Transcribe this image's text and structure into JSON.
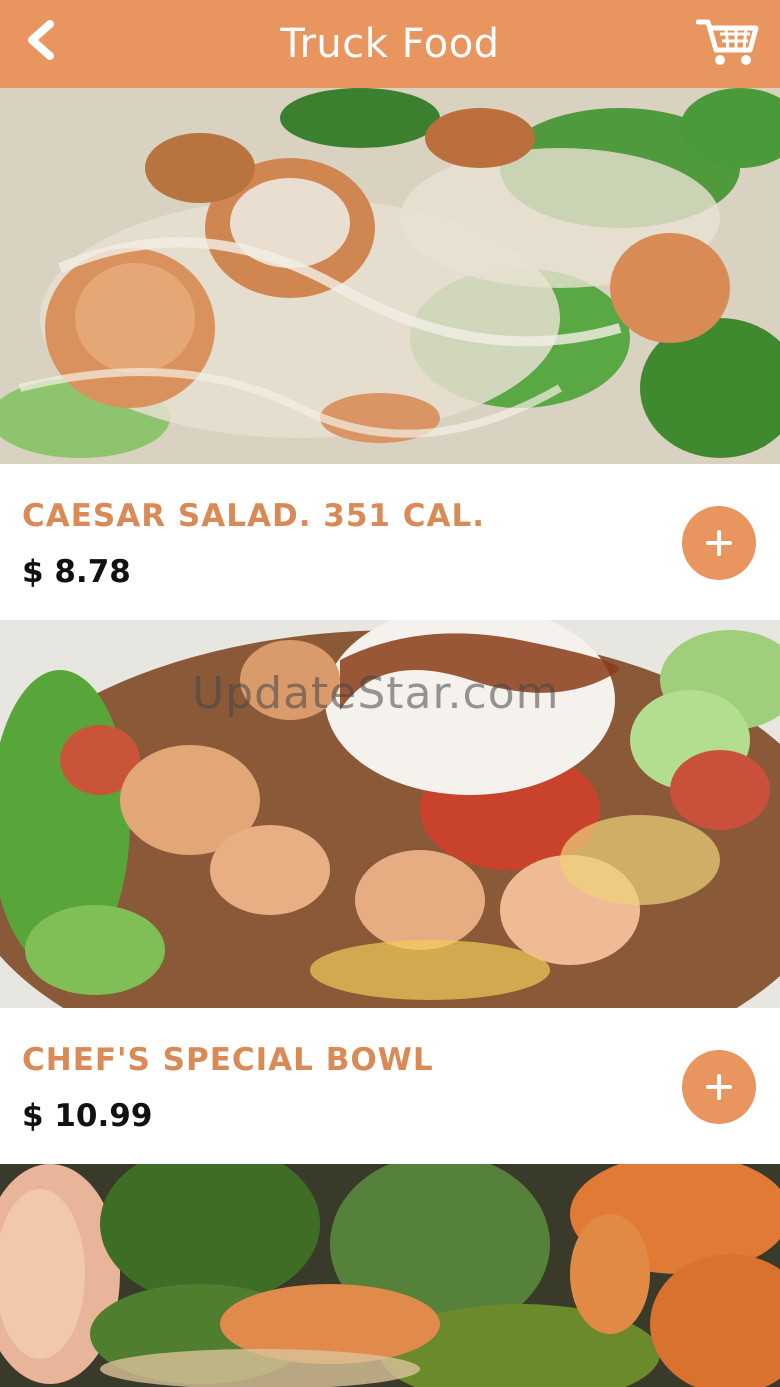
{
  "header": {
    "title": "Truck Food",
    "back_icon": "chevron-left-icon",
    "cart_icon": "shopping-cart-icon",
    "background_color": "#e8955f"
  },
  "menu": {
    "items": [
      {
        "name": "CAESAR SALAD. 351 CAL.",
        "price": "$ 8.78",
        "image": "caesar-salad-with-shrimp-photo"
      },
      {
        "name": "CHEF'S SPECIAL BOWL",
        "price": "$ 10.99",
        "image": "shrimp-taco-bowl-photo"
      },
      {
        "name": "",
        "price": "",
        "image": "broccoli-carrot-rice-bowl-photo"
      }
    ],
    "add_icon": "plus-icon",
    "accent_color": "#d98a56"
  },
  "watermark": {
    "text": "UpdateStar.com"
  }
}
